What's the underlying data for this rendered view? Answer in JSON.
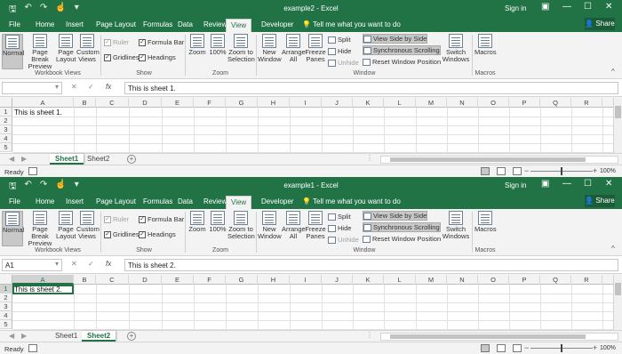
{
  "colors": {
    "excel_green": "#217346",
    "ribbon_bg": "#f3f3f3",
    "selection": "#217346"
  },
  "windows": [
    {
      "title": "example2 - Excel",
      "signin": "Sign in",
      "share": "Share",
      "tabs": [
        "File",
        "Home",
        "Insert",
        "Page Layout",
        "Formulas",
        "Data",
        "Review",
        "View",
        "Developer"
      ],
      "active_tab": "View",
      "tell_me": "Tell me what you want to do",
      "workbook_views": {
        "normal": "Normal",
        "page_break": "Page Break\nPreview",
        "page_layout": "Page\nLayout",
        "custom_views": "Custom\nViews",
        "label": "Workbook Views"
      },
      "show": {
        "ruler": "Ruler",
        "formula_bar": "Formula Bar",
        "gridlines": "Gridlines",
        "headings": "Headings",
        "label": "Show"
      },
      "zoom": {
        "zoom": "Zoom",
        "hundred": "100%",
        "zoom_sel": "Zoom to\nSelection",
        "label": "Zoom"
      },
      "window": {
        "new_window": "New\nWindow",
        "arrange_all": "Arrange\nAll",
        "freeze": "Freeze\nPanes",
        "split": "Split",
        "hide": "Hide",
        "unhide": "Unhide",
        "side_by_side": "View Side by Side",
        "sync_scroll": "Synchronous Scrolling",
        "reset_pos": "Reset Window Position",
        "switch": "Switch\nWindows",
        "label": "Window"
      },
      "macros": {
        "macros": "Macros",
        "label": "Macros"
      },
      "namebox": "",
      "formula": "This is sheet 1.",
      "columns": [
        "A",
        "B",
        "C",
        "D",
        "E",
        "F",
        "G",
        "H",
        "I",
        "J",
        "K",
        "L",
        "M",
        "N",
        "O",
        "P",
        "Q",
        "R"
      ],
      "rows": [
        "1",
        "2",
        "3",
        "4",
        "5"
      ],
      "cell_a1": "This is sheet 1.",
      "sheets": [
        "Sheet1",
        "Sheet2"
      ],
      "active_sheet": "Sheet1",
      "status": "Ready",
      "zoom_level": "100%"
    },
    {
      "title": "example1 - Excel",
      "signin": "Sign in",
      "share": "Share",
      "tabs": [
        "File",
        "Home",
        "Insert",
        "Page Layout",
        "Formulas",
        "Data",
        "Review",
        "View",
        "Developer"
      ],
      "active_tab": "View",
      "tell_me": "Tell me what you want to do",
      "workbook_views": {
        "normal": "Normal",
        "page_break": "Page Break\nPreview",
        "page_layout": "Page\nLayout",
        "custom_views": "Custom\nViews",
        "label": "Workbook Views"
      },
      "show": {
        "ruler": "Ruler",
        "formula_bar": "Formula Bar",
        "gridlines": "Gridlines",
        "headings": "Headings",
        "label": "Show"
      },
      "zoom": {
        "zoom": "Zoom",
        "hundred": "100%",
        "zoom_sel": "Zoom to\nSelection",
        "label": "Zoom"
      },
      "window": {
        "new_window": "New\nWindow",
        "arrange_all": "Arrange\nAll",
        "freeze": "Freeze\nPanes",
        "split": "Split",
        "hide": "Hide",
        "unhide": "Unhide",
        "side_by_side": "View Side by Side",
        "sync_scroll": "Synchronous Scrolling",
        "reset_pos": "Reset Window Position",
        "switch": "Switch\nWindows",
        "label": "Window"
      },
      "macros": {
        "macros": "Macros",
        "label": "Macros"
      },
      "namebox": "A1",
      "formula": "This is sheet 2.",
      "columns": [
        "A",
        "B",
        "C",
        "D",
        "E",
        "F",
        "G",
        "H",
        "I",
        "J",
        "K",
        "L",
        "M",
        "N",
        "O",
        "P",
        "Q",
        "R"
      ],
      "rows": [
        "1",
        "2",
        "3",
        "4",
        "5"
      ],
      "cell_a1": "This is sheet 2.",
      "sheets": [
        "Sheet1",
        "Sheet2"
      ],
      "active_sheet": "Sheet2",
      "status": "Ready",
      "zoom_level": "100%"
    }
  ]
}
